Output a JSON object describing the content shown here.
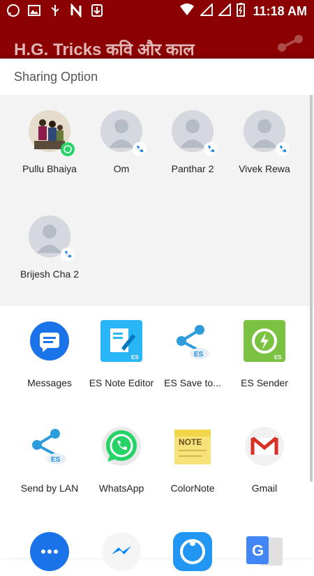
{
  "status_bar": {
    "time": "11:18 AM"
  },
  "app_bar": {
    "title": "H.G. Tricks कवि और काल"
  },
  "sheet": {
    "title": "Sharing Option",
    "contacts": [
      {
        "name": "Pullu Bhaiya",
        "badge": "whatsapp-icon"
      },
      {
        "name": "Om",
        "badge": "phone-icon"
      },
      {
        "name": "Panthar 2",
        "badge": "phone-icon"
      },
      {
        "name": "Vivek Rewa",
        "badge": "phone-icon"
      },
      {
        "name": "Brijesh Cha 2",
        "badge": "phone-icon"
      }
    ],
    "apps": [
      {
        "label": "Messages",
        "icon": "messages-icon"
      },
      {
        "label": "ES Note Editor",
        "icon": "es-note-editor-icon"
      },
      {
        "label": "ES Save to...",
        "icon": "es-save-icon"
      },
      {
        "label": "ES Sender",
        "icon": "es-sender-icon"
      },
      {
        "label": "Send by LAN",
        "icon": "send-by-lan-icon"
      },
      {
        "label": "WhatsApp",
        "icon": "whatsapp-icon"
      },
      {
        "label": "ColorNote",
        "icon": "colornote-icon"
      },
      {
        "label": "Gmail",
        "icon": "gmail-icon"
      },
      {
        "label": "",
        "icon": "chat-icon"
      },
      {
        "label": "",
        "icon": "messenger-icon"
      },
      {
        "label": "",
        "icon": "shareit-icon"
      },
      {
        "label": "",
        "icon": "google-translate-icon"
      }
    ]
  },
  "colors": {
    "app_bar": "#8b0000",
    "contacts_bg": "#f3f3f3"
  }
}
